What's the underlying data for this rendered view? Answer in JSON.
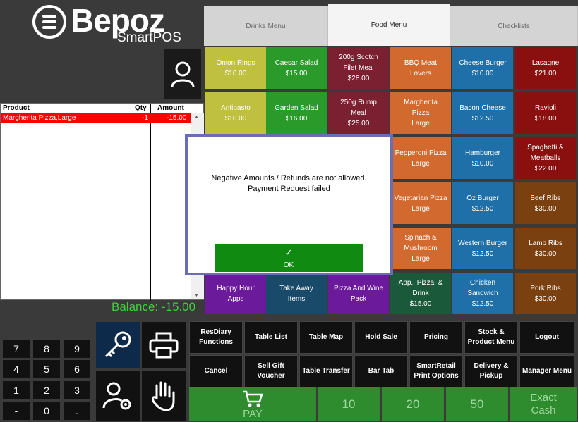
{
  "brand": {
    "name": "Bepoz",
    "subtitle": "SmartPOS"
  },
  "tabs": [
    {
      "label": "Drinks Menu"
    },
    {
      "label": "Food Menu"
    },
    {
      "label": "Checklists"
    }
  ],
  "order": {
    "headers": {
      "product": "Product",
      "qty": "Qty",
      "amount": "Amount"
    },
    "rows": [
      {
        "product": "Margherita Pizza,Large",
        "qty": "-1",
        "amount": "-15.00"
      }
    ],
    "balance": "Balance: -15.00"
  },
  "tiles": [
    {
      "lines": [
        "Onion Rings",
        "$10.00"
      ],
      "color": "#c0c040"
    },
    {
      "lines": [
        "Caesar Salad",
        "$15.00"
      ],
      "color": "#2a9a2a"
    },
    {
      "lines": [
        "200g Scotch",
        "Filet Meal",
        "$28.00"
      ],
      "color": "#7a2030"
    },
    {
      "lines": [
        "BBQ Meat",
        "Lovers"
      ],
      "color": "#d26a30"
    },
    {
      "lines": [
        "Cheese Burger",
        "$10.00"
      ],
      "color": "#1f6fa8"
    },
    {
      "lines": [
        "Lasagne",
        "$21.00"
      ],
      "color": "#8a1010"
    },
    {
      "lines": [
        "Antipasto",
        "$10.00"
      ],
      "color": "#c0c040"
    },
    {
      "lines": [
        "Garden Salad",
        "$16.00"
      ],
      "color": "#2a9a2a"
    },
    {
      "lines": [
        "250g Rump",
        "Meal",
        "$25.00"
      ],
      "color": "#7a2030"
    },
    {
      "lines": [
        "Margherita",
        "Pizza",
        "Large"
      ],
      "color": "#d26a30"
    },
    {
      "lines": [
        "Bacon Cheese",
        "$12.50"
      ],
      "color": "#1f6fa8"
    },
    {
      "lines": [
        "Ravioli",
        "$18.00"
      ],
      "color": "#8a1010"
    },
    {
      "lines": [
        "Pepperoni Pizza",
        "Large"
      ],
      "color": "#d26a30"
    },
    {
      "lines": [
        "Hamburger",
        "$10.00"
      ],
      "color": "#1f6fa8"
    },
    {
      "lines": [
        "Spaghetti &",
        "Meatballs",
        "$22.00"
      ],
      "color": "#8a1010"
    },
    {
      "lines": [
        "Vegetarian Pizza",
        "Large"
      ],
      "color": "#d26a30"
    },
    {
      "lines": [
        "Oz Burger",
        "$12.50"
      ],
      "color": "#1f6fa8"
    },
    {
      "lines": [
        "Beef Ribs",
        "$30.00"
      ],
      "color": "#7a4010"
    },
    {
      "lines": [
        "Spinach &",
        "Mushroom",
        "Large"
      ],
      "color": "#d26a30"
    },
    {
      "lines": [
        "Western Burger",
        "$12.50"
      ],
      "color": "#1f6fa8"
    },
    {
      "lines": [
        "Lamb Ribs",
        "$30.00"
      ],
      "color": "#7a4010"
    },
    {
      "lines": [
        "Happy Hour",
        "Apps"
      ],
      "color": "#6a1a9a"
    },
    {
      "lines": [
        "Take Away",
        "Items"
      ],
      "color": "#1a4a6a"
    },
    {
      "lines": [
        "Pizza And Wine",
        "Pack"
      ],
      "color": "#6a1a9a"
    },
    {
      "lines": [
        "App., Pizza, &",
        "Drink",
        "$15.00"
      ],
      "color": "#1a5a3a"
    },
    {
      "lines": [
        "Chicken",
        "Sandwich",
        "$12.50"
      ],
      "color": "#1f6fa8"
    },
    {
      "lines": [
        "Pork Ribs",
        "$30.00"
      ],
      "color": "#7a4010"
    }
  ],
  "numpad": [
    "7",
    "8",
    "9",
    "4",
    "5",
    "6",
    "1",
    "2",
    "3",
    "-",
    "0",
    "."
  ],
  "functions": [
    {
      "label": "ResDiary Functions"
    },
    {
      "label": "Table List"
    },
    {
      "label": "Table Map"
    },
    {
      "label": "Hold Sale"
    },
    {
      "label": "Pricing"
    },
    {
      "label": "Stock & Product Menu"
    },
    {
      "label": "Logout"
    },
    {
      "label": "Cancel"
    },
    {
      "label": "Sell Gift Voucher"
    },
    {
      "label": "Table Transfer"
    },
    {
      "label": "Bar Tab"
    },
    {
      "label": "SmartRetail Print Options"
    },
    {
      "label": "Delivery & Pickup"
    },
    {
      "label": "Manager Menu"
    }
  ],
  "payment": {
    "pay": "PAY",
    "cash10": "10",
    "cash20": "20",
    "cash50": "50",
    "exact_cash": "Exact Cash"
  },
  "dialog": {
    "message_line1": "Negative Amounts / Refunds are not allowed.",
    "message_line2": "Payment Request failed",
    "ok_label": "OK",
    "ok_check": "✓"
  }
}
